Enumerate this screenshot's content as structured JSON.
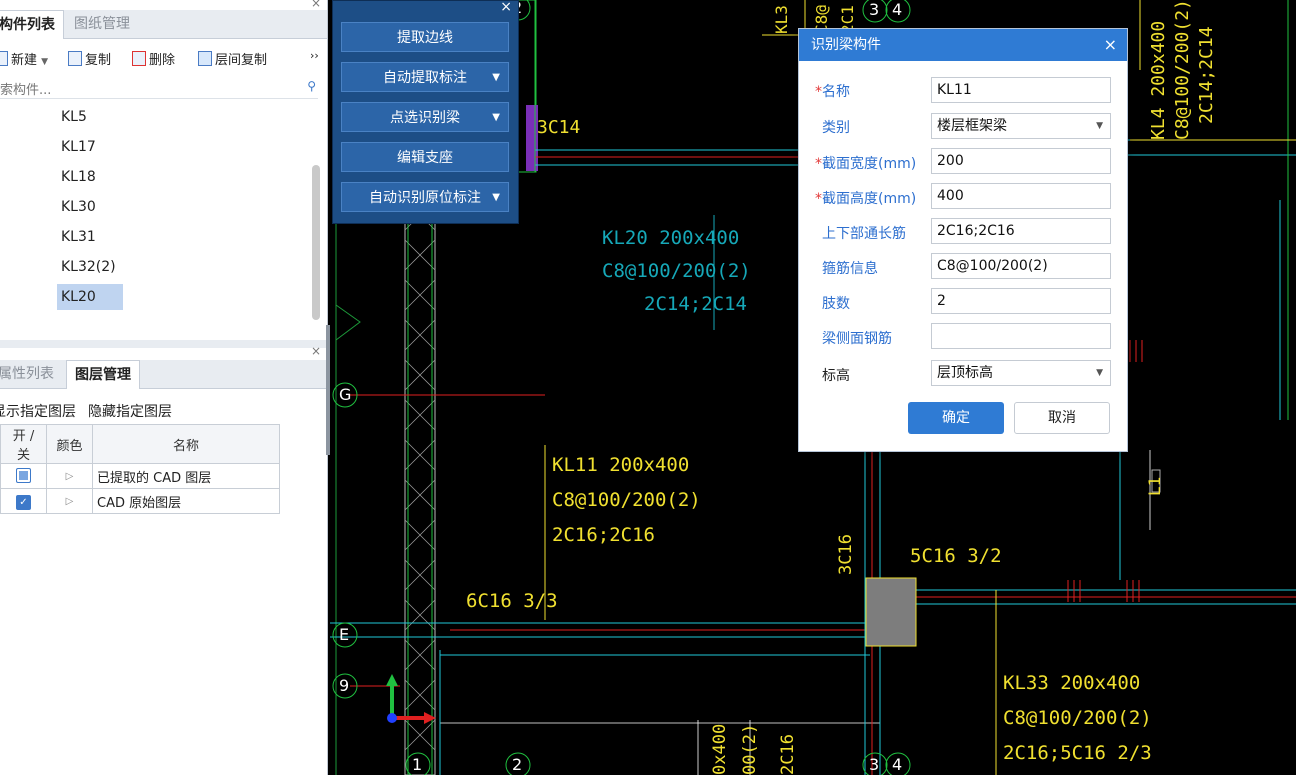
{
  "component_panel": {
    "tabs": [
      "构件列表",
      "图纸管理"
    ],
    "toolbar": {
      "new": "新建",
      "copy": "复制",
      "delete": "删除",
      "floor_copy": "层间复制",
      "more": "››"
    },
    "search_placeholder": "索构件...",
    "items": [
      "KL5",
      "KL17",
      "KL18",
      "KL30",
      "KL31",
      "KL32(2)",
      "KL20"
    ],
    "selected_item": "KL20"
  },
  "layer_panel": {
    "tabs": [
      "属性列表",
      "图层管理"
    ],
    "actions": {
      "show": "显示指定图层",
      "hide": "隐藏指定图层"
    },
    "columns": [
      "开 / 关",
      "颜色",
      "名称"
    ],
    "rows": [
      {
        "state": "partial",
        "name": "已提取的 CAD 图层"
      },
      {
        "state": "checked",
        "name": "CAD 原始图层"
      }
    ]
  },
  "recognize_panel": {
    "buttons": [
      "提取边线",
      "自动提取标注",
      "点选识别梁",
      "编辑支座",
      "自动识别原位标注"
    ]
  },
  "dialog": {
    "title": "识别梁构件",
    "fields": [
      {
        "label": "名称",
        "required": true,
        "value": "KL11",
        "type": "text"
      },
      {
        "label": "类别",
        "required": false,
        "value": "楼层框架梁",
        "type": "select"
      },
      {
        "label": "截面宽度(mm)",
        "required": true,
        "value": "200",
        "type": "text"
      },
      {
        "label": "截面高度(mm)",
        "required": true,
        "value": "400",
        "type": "text"
      },
      {
        "label": "上下部通长筋",
        "required": false,
        "value": "2C16;2C16",
        "type": "text"
      },
      {
        "label": "箍筋信息",
        "required": false,
        "value": "C8@100/200(2)",
        "type": "text"
      },
      {
        "label": "肢数",
        "required": false,
        "value": "2",
        "type": "text"
      },
      {
        "label": "梁侧面钢筋",
        "required": false,
        "value": "",
        "type": "text"
      },
      {
        "label": "标高",
        "required": false,
        "value": "层顶标高",
        "type": "select"
      }
    ],
    "ok": "确定",
    "cancel": "取消"
  },
  "cad": {
    "annotations": [
      {
        "id": "kl20",
        "lines": [
          "KL20 200x400",
          "C8@100/200(2)",
          "2C14;2C14"
        ],
        "color": "#16a8b8"
      },
      {
        "id": "kl11",
        "lines": [
          "KL11 200x400",
          "C8@100/200(2)",
          "2C16;2C16"
        ],
        "color": "#f0e030"
      },
      {
        "id": "kl33",
        "lines": [
          "KL33 200x400",
          "C8@100/200(2)",
          "2C16;5C16 2/3"
        ],
        "color": "#f0e030"
      },
      {
        "id": "kl4",
        "lines": [
          "KL4 200x400",
          "C8@100/200(2)",
          "2C14;2C14"
        ],
        "color": "#f0e030"
      }
    ],
    "labels": {
      "c14": "3C14",
      "c16a": "6C16 3/3",
      "c16b": "5C16 3/2",
      "c16v": "3C16",
      "l1": "L1"
    },
    "axis_labels": [
      "G",
      "E",
      "9",
      "1",
      "2",
      "3",
      "4",
      "3",
      "4",
      "2"
    ],
    "bottom_texts": [
      "0x400",
      "00(2)",
      "2C16"
    ],
    "top_texts": [
      "KL3",
      "C8@",
      "2C1"
    ]
  },
  "colors": {
    "accent": "#2f7bd4",
    "cad_cyan": "#20c8d8",
    "cad_yellow": "#f0e030",
    "cad_red": "#e02020",
    "cad_green": "#20c040"
  }
}
